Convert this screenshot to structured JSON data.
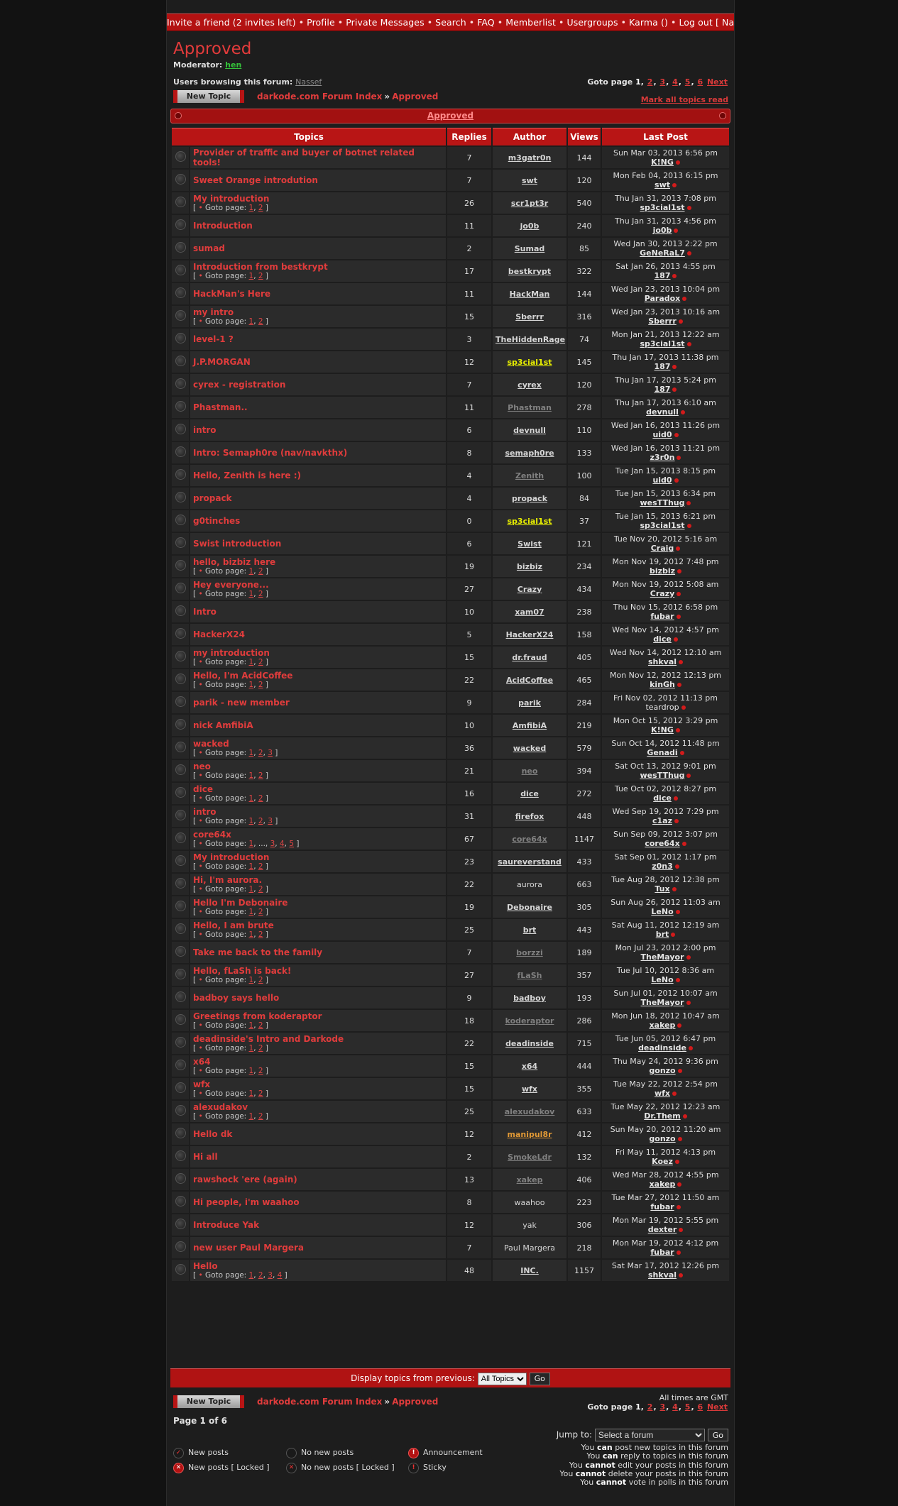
{
  "nav": {
    "items": [
      "Invite a friend (2 invites left)",
      "Profile",
      "Private Messages",
      "Search",
      "FAQ",
      "Memberlist",
      "Usergroups",
      "Karma ()",
      "Log out [ Nassef ]"
    ],
    "separator": "•"
  },
  "forum": {
    "title": "Approved",
    "moderator_label": "Moderator:",
    "moderator": "hen",
    "browsing_label": "Users browsing this forum:",
    "browsing_user": "Nassef"
  },
  "pagination": {
    "label": "Goto page",
    "current": "1",
    "pages": [
      "2",
      "3",
      "4",
      "5",
      "6"
    ],
    "next": "Next",
    "page_of": "Page 1 of 6"
  },
  "actions": {
    "new_topic": "New Topic",
    "mark_all": "Mark all topics read"
  },
  "breadcrumb": {
    "index": "darkode.com Forum Index",
    "arrow": "»",
    "current": "Approved"
  },
  "table": {
    "category": "Approved",
    "headers": [
      "Topics",
      "Replies",
      "Author",
      "Views",
      "Last Post"
    ],
    "goto_label": "Goto page:",
    "rows": [
      {
        "t": "Provider of traffic and buyer of botnet related tools!",
        "p": [],
        "r": "7",
        "a": "m3gatr0n",
        "as": "",
        "v": "144",
        "d": "Sun Mar 03, 2013 6:56 pm",
        "lu": "K!NG",
        "ls": ""
      },
      {
        "t": "Sweet Orange introdution",
        "p": [],
        "r": "7",
        "a": "swt",
        "as": "",
        "v": "120",
        "d": "Mon Feb 04, 2013 6:15 pm",
        "lu": "swt",
        "ls": ""
      },
      {
        "t": "My introduction",
        "p": [
          "1",
          "2"
        ],
        "r": "26",
        "a": "scr1pt3r",
        "as": "",
        "v": "540",
        "d": "Thu Jan 31, 2013 7:08 pm",
        "lu": "sp3cial1st",
        "ls": ""
      },
      {
        "t": "Introduction",
        "p": [],
        "r": "11",
        "a": "jo0b",
        "as": "",
        "v": "240",
        "d": "Thu Jan 31, 2013 4:56 pm",
        "lu": "jo0b",
        "ls": ""
      },
      {
        "t": "sumad",
        "p": [],
        "r": "2",
        "a": "Sumad",
        "as": "",
        "v": "85",
        "d": "Wed Jan 30, 2013 2:22 pm",
        "lu": "GeNeRaL7",
        "ls": ""
      },
      {
        "t": "Introduction from bestkrypt",
        "p": [
          "1",
          "2"
        ],
        "r": "17",
        "a": "bestkrypt",
        "as": "",
        "v": "322",
        "d": "Sat Jan 26, 2013 4:55 pm",
        "lu": "187",
        "ls": ""
      },
      {
        "t": "HackMan's Here",
        "p": [],
        "r": "11",
        "a": "HackMan",
        "as": "",
        "v": "144",
        "d": "Wed Jan 23, 2013 10:04 pm",
        "lu": "Paradox",
        "ls": ""
      },
      {
        "t": "my intro",
        "p": [
          "1",
          "2"
        ],
        "r": "15",
        "a": "Sberrr",
        "as": "",
        "v": "316",
        "d": "Wed Jan 23, 2013 10:16 am",
        "lu": "Sberrr",
        "ls": ""
      },
      {
        "t": "level-1 ?",
        "p": [],
        "r": "3",
        "a": "TheHiddenRage",
        "as": "",
        "v": "74",
        "d": "Mon Jan 21, 2013 12:22 am",
        "lu": "sp3cial1st",
        "ls": ""
      },
      {
        "t": "J.P.MORGAN",
        "p": [],
        "r": "12",
        "a": "sp3cial1st",
        "as": "yellow",
        "v": "145",
        "d": "Thu Jan 17, 2013 11:38 pm",
        "lu": "187",
        "ls": ""
      },
      {
        "t": "cyrex - registration",
        "p": [],
        "r": "7",
        "a": "cyrex",
        "as": "",
        "v": "120",
        "d": "Thu Jan 17, 2013 5:24 pm",
        "lu": "187",
        "ls": ""
      },
      {
        "t": "Phastman..",
        "p": [],
        "r": "11",
        "a": "Phastman",
        "as": "muted",
        "v": "278",
        "d": "Thu Jan 17, 2013 6:10 am",
        "lu": "devnull",
        "ls": ""
      },
      {
        "t": "intro",
        "p": [],
        "r": "6",
        "a": "devnull",
        "as": "",
        "v": "110",
        "d": "Wed Jan 16, 2013 11:26 pm",
        "lu": "uid0",
        "ls": ""
      },
      {
        "t": "Intro: Semaph0re (nav/navkthx)",
        "p": [],
        "r": "8",
        "a": "semaph0re",
        "as": "",
        "v": "133",
        "d": "Wed Jan 16, 2013 11:21 pm",
        "lu": "z3r0n",
        "ls": ""
      },
      {
        "t": "Hello, Zenith is here :)",
        "p": [],
        "r": "4",
        "a": "Zenith",
        "as": "muted",
        "v": "100",
        "d": "Tue Jan 15, 2013 8:15 pm",
        "lu": "uid0",
        "ls": ""
      },
      {
        "t": "propack",
        "p": [],
        "r": "4",
        "a": "propack",
        "as": "",
        "v": "84",
        "d": "Tue Jan 15, 2013 6:34 pm",
        "lu": "wesTThug",
        "ls": ""
      },
      {
        "t": "g0tinches",
        "p": [],
        "r": "0",
        "a": "sp3cial1st",
        "as": "yellow",
        "v": "37",
        "d": "Tue Jan 15, 2013 6:21 pm",
        "lu": "sp3cial1st",
        "ls": ""
      },
      {
        "t": "Swist introduction",
        "p": [],
        "r": "6",
        "a": "Swist",
        "as": "",
        "v": "121",
        "d": "Tue Nov 20, 2012 5:16 am",
        "lu": "Craig",
        "ls": ""
      },
      {
        "t": "hello, bizbiz here",
        "p": [
          "1",
          "2"
        ],
        "r": "19",
        "a": "bizbiz",
        "as": "",
        "v": "234",
        "d": "Mon Nov 19, 2012 7:48 pm",
        "lu": "bizbiz",
        "ls": ""
      },
      {
        "t": "Hey everyone...",
        "p": [
          "1",
          "2"
        ],
        "r": "27",
        "a": "Crazy",
        "as": "",
        "v": "434",
        "d": "Mon Nov 19, 2012 5:08 am",
        "lu": "Crazy",
        "ls": ""
      },
      {
        "t": "Intro",
        "p": [],
        "r": "10",
        "a": "xam07",
        "as": "",
        "v": "238",
        "d": "Thu Nov 15, 2012 6:58 pm",
        "lu": "fubar",
        "ls": ""
      },
      {
        "t": "HackerX24",
        "p": [],
        "r": "5",
        "a": "HackerX24",
        "as": "",
        "v": "158",
        "d": "Wed Nov 14, 2012 4:57 pm",
        "lu": "dice",
        "ls": ""
      },
      {
        "t": "my introduction",
        "p": [
          "1",
          "2"
        ],
        "r": "15",
        "a": "dr.fraud",
        "as": "",
        "v": "405",
        "d": "Wed Nov 14, 2012 12:10 am",
        "lu": "shkval",
        "ls": ""
      },
      {
        "t": "Hello, I'm AcidCoffee",
        "p": [
          "1",
          "2"
        ],
        "r": "22",
        "a": "AcidCoffee",
        "as": "",
        "v": "465",
        "d": "Mon Nov 12, 2012 12:13 pm",
        "lu": "kinGh",
        "ls": ""
      },
      {
        "t": "parik - new member",
        "p": [],
        "r": "9",
        "a": "parik",
        "as": "",
        "v": "284",
        "d": "Fri Nov 02, 2012 11:13 pm",
        "lu": "teardrop",
        "ls": "plain"
      },
      {
        "t": "nick AmfibiA",
        "p": [],
        "r": "10",
        "a": "AmfibiA",
        "as": "",
        "v": "219",
        "d": "Mon Oct 15, 2012 3:29 pm",
        "lu": "K!NG",
        "ls": ""
      },
      {
        "t": "wacked",
        "p": [
          "1",
          "2",
          "3"
        ],
        "r": "36",
        "a": "wacked",
        "as": "",
        "v": "579",
        "d": "Sun Oct 14, 2012 11:48 pm",
        "lu": "Genadi",
        "ls": ""
      },
      {
        "t": "neo",
        "p": [
          "1",
          "2"
        ],
        "r": "21",
        "a": "neo",
        "as": "muted",
        "v": "394",
        "d": "Sat Oct 13, 2012 9:01 pm",
        "lu": "wesTThug",
        "ls": ""
      },
      {
        "t": "dice",
        "p": [
          "1",
          "2"
        ],
        "r": "16",
        "a": "dice",
        "as": "",
        "v": "272",
        "d": "Tue Oct 02, 2012 8:27 pm",
        "lu": "dice",
        "ls": ""
      },
      {
        "t": "intro",
        "p": [
          "1",
          "2",
          "3"
        ],
        "r": "31",
        "a": "firefox",
        "as": "",
        "v": "448",
        "d": "Wed Sep 19, 2012 7:29 pm",
        "lu": "c1az",
        "ls": ""
      },
      {
        "t": "core64x",
        "p": [
          "1",
          "...",
          "3",
          "4",
          "5"
        ],
        "r": "67",
        "a": "core64x",
        "as": "muted",
        "v": "1147",
        "d": "Sun Sep 09, 2012 3:07 pm",
        "lu": "core64x",
        "ls": ""
      },
      {
        "t": "My introduction",
        "p": [
          "1",
          "2"
        ],
        "r": "23",
        "a": "saureverstand",
        "as": "",
        "v": "433",
        "d": "Sat Sep 01, 2012 1:17 pm",
        "lu": "z0n3",
        "ls": ""
      },
      {
        "t": "Hi, I'm aurora.",
        "p": [
          "1",
          "2"
        ],
        "r": "22",
        "a": "aurora",
        "as": "plain",
        "v": "663",
        "d": "Tue Aug 28, 2012 12:38 pm",
        "lu": "Tux",
        "ls": ""
      },
      {
        "t": "Hello I'm Debonaire",
        "p": [
          "1",
          "2"
        ],
        "r": "19",
        "a": "Debonaire",
        "as": "",
        "v": "305",
        "d": "Sun Aug 26, 2012 11:03 am",
        "lu": "LeNo",
        "ls": ""
      },
      {
        "t": "Hello, I am brute",
        "p": [
          "1",
          "2"
        ],
        "r": "25",
        "a": "brt",
        "as": "",
        "v": "443",
        "d": "Sat Aug 11, 2012 12:19 am",
        "lu": "brt",
        "ls": ""
      },
      {
        "t": "Take me back to the family",
        "p": [],
        "r": "7",
        "a": "borzzi",
        "as": "muted",
        "v": "189",
        "d": "Mon Jul 23, 2012 2:00 pm",
        "lu": "TheMayor",
        "ls": ""
      },
      {
        "t": "Hello, fLaSh is back!",
        "p": [
          "1",
          "2"
        ],
        "r": "27",
        "a": "fLaSh",
        "as": "muted",
        "v": "357",
        "d": "Tue Jul 10, 2012 8:36 am",
        "lu": "LeNo",
        "ls": ""
      },
      {
        "t": "badboy says hello",
        "p": [],
        "r": "9",
        "a": "badboy",
        "as": "",
        "v": "193",
        "d": "Sun Jul 01, 2012 10:07 am",
        "lu": "TheMayor",
        "ls": ""
      },
      {
        "t": "Greetings from koderaptor",
        "p": [
          "1",
          "2"
        ],
        "r": "18",
        "a": "koderaptor",
        "as": "muted",
        "v": "286",
        "d": "Mon Jun 18, 2012 10:47 am",
        "lu": "xakep",
        "ls": ""
      },
      {
        "t": "deadinside's Intro and Darkode",
        "p": [
          "1",
          "2"
        ],
        "r": "22",
        "a": "deadinside",
        "as": "",
        "v": "715",
        "d": "Tue Jun 05, 2012 6:47 pm",
        "lu": "deadinside",
        "ls": ""
      },
      {
        "t": "x64",
        "p": [
          "1",
          "2"
        ],
        "r": "15",
        "a": "x64",
        "as": "",
        "v": "444",
        "d": "Thu May 24, 2012 9:36 pm",
        "lu": "gonzo",
        "ls": ""
      },
      {
        "t": "wfx",
        "p": [
          "1",
          "2"
        ],
        "r": "15",
        "a": "wfx",
        "as": "",
        "v": "355",
        "d": "Tue May 22, 2012 2:54 pm",
        "lu": "wfx",
        "ls": ""
      },
      {
        "t": "alexudakov",
        "p": [
          "1",
          "2"
        ],
        "r": "25",
        "a": "alexudakov",
        "as": "muted",
        "v": "633",
        "d": "Tue May 22, 2012 12:23 am",
        "lu": "Dr.Them",
        "ls": ""
      },
      {
        "t": "Hello dk",
        "p": [],
        "r": "12",
        "a": "manipul8r",
        "as": "orange",
        "v": "412",
        "d": "Sun May 20, 2012 11:20 am",
        "lu": "gonzo",
        "ls": ""
      },
      {
        "t": "Hi all",
        "p": [],
        "r": "2",
        "a": "SmokeLdr",
        "as": "muted",
        "v": "132",
        "d": "Fri May 11, 2012 4:13 pm",
        "lu": "Koez",
        "ls": ""
      },
      {
        "t": "rawshock 'ere (again)",
        "p": [],
        "r": "13",
        "a": "xakep",
        "as": "muted",
        "v": "406",
        "d": "Wed Mar 28, 2012 4:55 pm",
        "lu": "xakep",
        "ls": ""
      },
      {
        "t": "Hi people, i'm waahoo",
        "p": [],
        "r": "8",
        "a": "waahoo",
        "as": "plain",
        "v": "223",
        "d": "Tue Mar 27, 2012 11:50 am",
        "lu": "fubar",
        "ls": ""
      },
      {
        "t": "Introduce Yak",
        "p": [],
        "r": "12",
        "a": "yak",
        "as": "plain",
        "v": "306",
        "d": "Mon Mar 19, 2012 5:55 pm",
        "lu": "dexter",
        "ls": ""
      },
      {
        "t": "new user Paul Margera",
        "p": [],
        "r": "7",
        "a": "Paul Margera",
        "as": "plain",
        "v": "218",
        "d": "Mon Mar 19, 2012 4:12 pm",
        "lu": "fubar",
        "ls": ""
      },
      {
        "t": "Hello",
        "p": [
          "1",
          "2",
          "3",
          "4"
        ],
        "r": "48",
        "a": "INC.",
        "as": "",
        "v": "1157",
        "d": "Sat Mar 17, 2012 12:26 pm",
        "lu": "shkval",
        "ls": ""
      }
    ]
  },
  "display": {
    "label": "Display topics from previous:",
    "selected": "All Topics",
    "go": "Go"
  },
  "footer": {
    "timezone": "All times are GMT",
    "jump_label": "Jump to:",
    "jump_placeholder": "Select a forum",
    "jump_go": "Go",
    "legend": [
      {
        "label": "New posts",
        "icon": "new-posts-icon"
      },
      {
        "label": "No new posts",
        "icon": "no-new-posts-icon"
      },
      {
        "label": "Announcement",
        "icon": "announcement-icon"
      },
      {
        "label": "New posts [ Locked ]",
        "icon": "new-posts-locked-icon"
      },
      {
        "label": "No new posts [ Locked ]",
        "icon": "no-new-posts-locked-icon"
      },
      {
        "label": "Sticky",
        "icon": "sticky-icon"
      }
    ],
    "permissions": [
      {
        "pre": "You",
        "verb": "can",
        "post": "post new topics in this forum"
      },
      {
        "pre": "You",
        "verb": "can",
        "post": "reply to topics in this forum"
      },
      {
        "pre": "You",
        "verb": "cannot",
        "post": "edit your posts in this forum"
      },
      {
        "pre": "You",
        "verb": "cannot",
        "post": "delete your posts in this forum"
      },
      {
        "pre": "You",
        "verb": "cannot",
        "post": "vote in polls in this forum"
      }
    ]
  },
  "colors": {
    "accent": "#b81515",
    "title": "#e03c3c",
    "background": "#1d1d1d"
  }
}
